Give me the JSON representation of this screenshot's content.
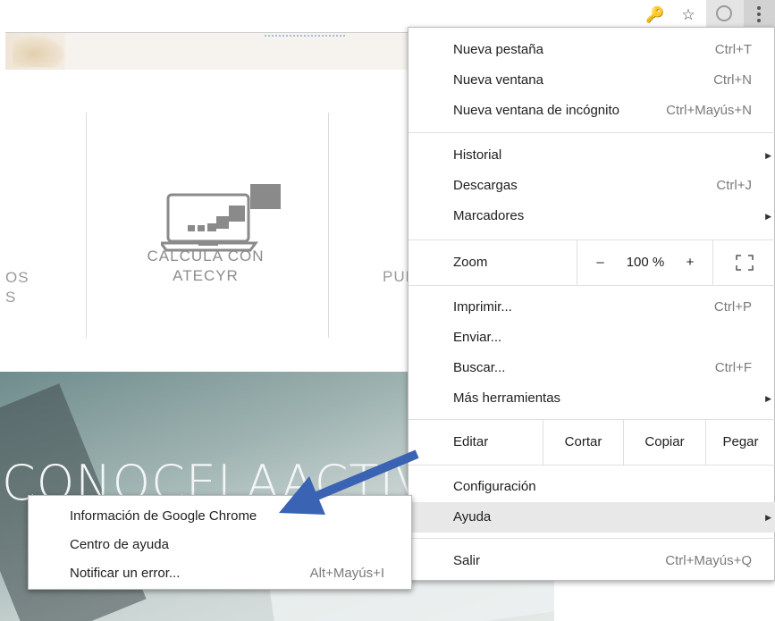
{
  "toolbar": {
    "key_icon": "🔑",
    "star_icon": "☆",
    "menu_icon": "kebab-menu-icon"
  },
  "page": {
    "services_left_partial": "OS\nS",
    "services_center": "CALCULA CON\nATECYR",
    "services_right_partial": "PUE",
    "banner_text": "CONOCELAACTIVI"
  },
  "chrome_menu": {
    "new_tab": {
      "label": "Nueva pestaña",
      "shortcut": "Ctrl+T"
    },
    "new_window": {
      "label": "Nueva ventana",
      "shortcut": "Ctrl+N"
    },
    "incognito": {
      "label": "Nueva ventana de incógnito",
      "shortcut": "Ctrl+Mayús+N"
    },
    "history": {
      "label": "Historial"
    },
    "downloads": {
      "label": "Descargas",
      "shortcut": "Ctrl+J"
    },
    "bookmarks": {
      "label": "Marcadores"
    },
    "zoom": {
      "label": "Zoom",
      "minus": "–",
      "value": "100 %",
      "plus": "+"
    },
    "print": {
      "label": "Imprimir...",
      "shortcut": "Ctrl+P"
    },
    "send": {
      "label": "Enviar..."
    },
    "find": {
      "label": "Buscar...",
      "shortcut": "Ctrl+F"
    },
    "more_tools": {
      "label": "Más herramientas"
    },
    "edit": {
      "label": "Editar",
      "cut": "Cortar",
      "copy": "Copiar",
      "paste": "Pegar"
    },
    "settings": {
      "label": "Configuración"
    },
    "help": {
      "label": "Ayuda"
    },
    "exit": {
      "label": "Salir",
      "shortcut": "Ctrl+Mayús+Q"
    }
  },
  "help_menu": {
    "about": {
      "label": "Información de Google Chrome"
    },
    "help_center": {
      "label": "Centro de ayuda"
    },
    "report": {
      "label": "Notificar un error...",
      "shortcut": "Alt+Mayús+I"
    }
  },
  "colors": {
    "annotation_arrow": "#3b63b4",
    "highlight": "#e8e8e8"
  }
}
